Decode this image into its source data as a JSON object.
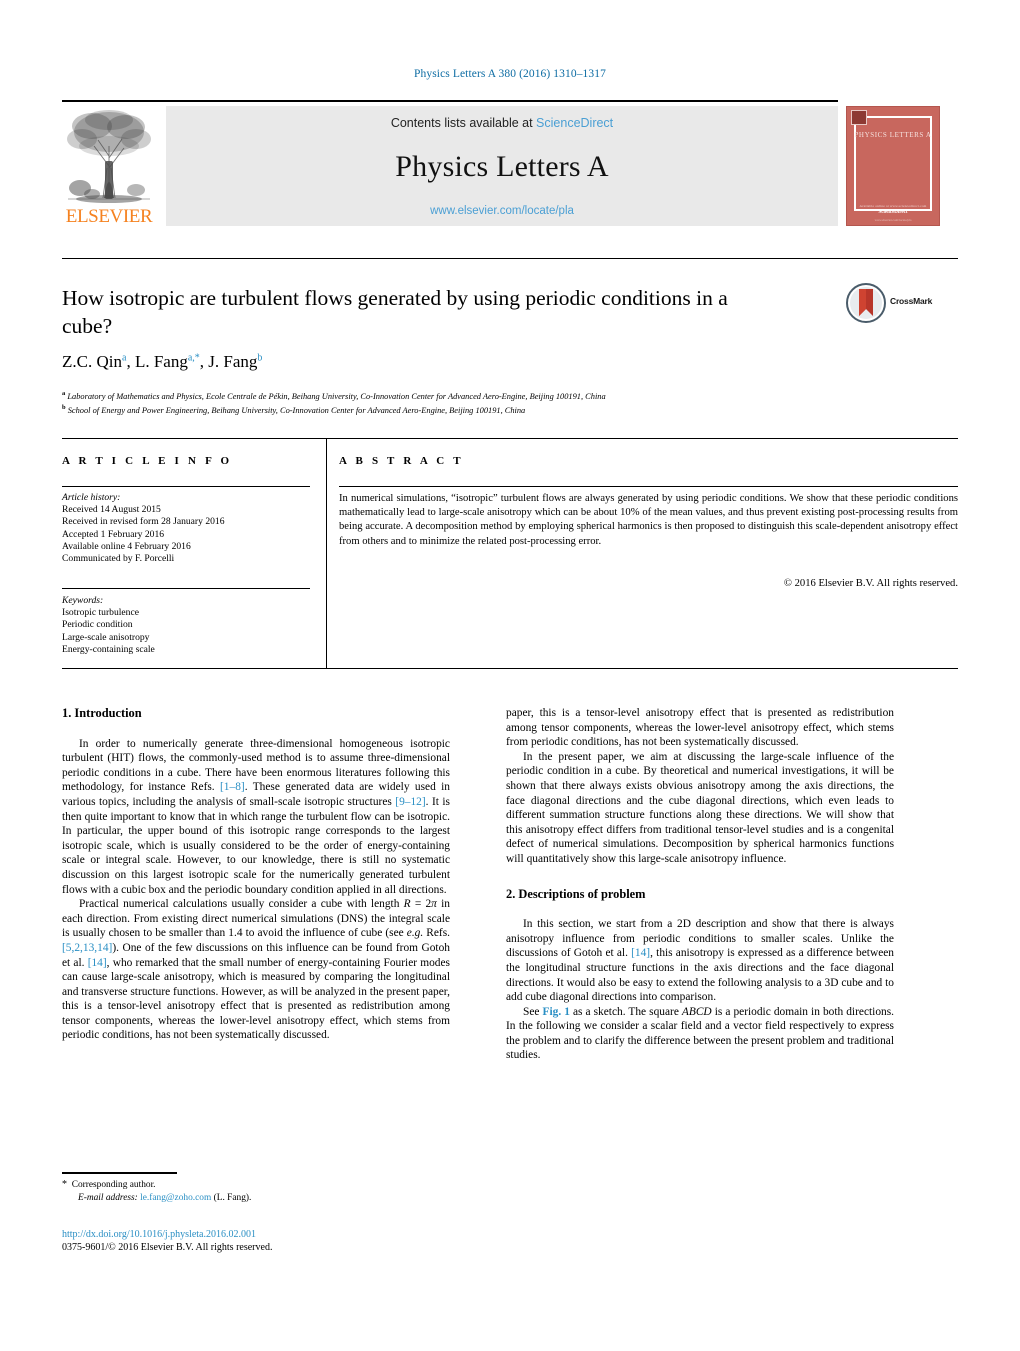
{
  "running_head": "Physics Letters A 380 (2016) 1310–1317",
  "masthead": {
    "contents_prefix": "Contents lists available at ",
    "sciencedirect": "ScienceDirect",
    "journal_title": "Physics Letters A",
    "journal_url": "www.elsevier.com/locate/pla",
    "publisher_wordmark": "ELSEVIER",
    "cover": {
      "title": "PHYSICS LETTERS A",
      "foot_small": "Available online at www.sciencedirect.com",
      "foot_brand": "ScienceDirect",
      "bottom_bar": "www.elsevier.com/locate/pla"
    }
  },
  "article": {
    "title": "How isotropic are turbulent flows generated by using periodic conditions in a cube?",
    "crossmark_label": "CrossMark",
    "authors_html": "Z.C. Qin<sup>a</sup>, L. Fang<sup>a,</sup><sup>*</sup>, J. Fang<sup>b</sup>",
    "affiliation_a": "Laboratory of Mathematics and Physics, Ecole Centrale de Pékin, Beihang University, Co-Innovation Center for Advanced Aero-Engine, Beijing 100191, China",
    "affiliation_b": "School of Energy and Power Engineering, Beihang University, Co-Innovation Center for Advanced Aero-Engine, Beijing 100191, China"
  },
  "info": {
    "heading": "A R T I C L E   I N F O",
    "history_label": "Article history:",
    "history": [
      "Received 14 August 2015",
      "Received in revised form 28 January 2016",
      "Accepted 1 February 2016",
      "Available online 4 February 2016",
      "Communicated by F. Porcelli"
    ],
    "keywords_label": "Keywords:",
    "keywords": [
      "Isotropic turbulence",
      "Periodic condition",
      "Large-scale anisotropy",
      "Energy-containing scale"
    ]
  },
  "abstract": {
    "heading": "A B S T R A C T",
    "text": "In numerical simulations, “isotropic” turbulent flows are always generated by using periodic conditions. We show that these periodic conditions mathematically lead to large-scale anisotropy which can be about 10% of the mean values, and thus prevent existing post-processing results from being accurate. A decomposition method by employing spherical harmonics is then proposed to distinguish this scale-dependent anisotropy effect from others and to minimize the related post-processing error.",
    "copyright": "© 2016 Elsevier B.V. All rights reserved."
  },
  "body": {
    "section1_heading": "1. Introduction",
    "section1_p1_html": "In order to numerically generate three-dimensional homogeneous isotropic turbulent (HIT) flows, the commonly-used method is to assume three-dimensional periodic conditions in a cube. There have been enormous literatures following this methodology, for instance Refs. <span class=\"ref\">[1–8]</span>. These generated data are widely used in various topics, including the analysis of small-scale isotropic structures <span class=\"ref\">[9–12]</span>. It is then quite important to know that in which range the turbulent flow can be isotropic. In particular, the upper bound of this isotropic range corresponds to the largest isotropic scale, which is usually considered to be the order of energy-containing scale or integral scale. However, to our knowledge, there is still no systematic discussion on this largest isotropic scale for the numerically generated turbulent flows with a cubic box and the periodic boundary condition applied in all directions.",
    "section1_p2_html": "Practical numerical calculations usually consider a cube with length <i>R</i> = 2<i>π</i> in each direction. From existing direct numerical simulations (DNS) the integral scale is usually chosen to be smaller than 1.4 to avoid the influence of cube (see <i>e.g.</i> Refs. <span class=\"ref\">[5,2,13,14]</span>). One of the few discussions on this influence can be found from Gotoh et al. <span class=\"ref\">[14]</span>, who remarked that the small number of energy-containing Fourier modes can cause large-scale anisotropy, which is measured by comparing the longitudinal and transverse structure functions. However, as will be analyzed in the present paper, this is a tensor-level anisotropy effect that is presented as redistribution among tensor components, whereas the lower-level anisotropy effect, which stems from periodic conditions, has not been systematically discussed.",
    "right_p1_html": "paper, this is a tensor-level anisotropy effect that is presented as redistribution among tensor components, whereas the lower-level anisotropy effect, which stems from periodic conditions, has not been systematically discussed.",
    "right_p2_html": "In the present paper, we aim at discussing the large-scale influence of the periodic condition in a cube. By theoretical and numerical investigations, it will be shown that there always exists obvious anisotropy among the axis directions, the face diagonal directions and the cube diagonal directions, which even leads to different summation structure functions along these directions. We will show that this anisotropy effect differs from traditional tensor-level studies and is a congenital defect of numerical simulations. Decomposition by spherical harmonics functions will quantitatively show this large-scale anisotropy influence.",
    "section2_heading": "2. Descriptions of problem",
    "section2_p1_html": "In this section, we start from a 2D description and show that there is always anisotropy influence from periodic conditions to smaller scales. Unlike the discussions of Gotoh et al. <span class=\"ref\">[14]</span>, this anisotropy is expressed as a difference between the longitudinal structure functions in the axis directions and the face diagonal directions. It would also be easy to extend the following analysis to a 3D cube and to add cube diagonal directions into comparison.",
    "section2_p2_html": "See <span class=\"figref\">Fig. 1</span> as a sketch. The square <i>ABCD</i> is a periodic domain in both directions. In the following we consider a scalar field and a vector field respectively to express the problem and to clarify the difference between the present problem and traditional studies."
  },
  "footer": {
    "corresponding_star": "*",
    "corresponding_author": "Corresponding author.",
    "email_label": "E-mail address:",
    "email": "le.fang@zoho.com",
    "email_owner": "(L. Fang).",
    "doi": "http://dx.doi.org/10.1016/j.physleta.2016.02.001",
    "issn_line": "0375-9601/© 2016 Elsevier B.V. All rights reserved."
  },
  "colors": {
    "link_blue": "#2a8fc4",
    "header_blue": "#0d6ca3",
    "elsevier_orange": "#F58220",
    "cover_red": "#c8675e",
    "masthead_gray": "#e9e9e9"
  }
}
